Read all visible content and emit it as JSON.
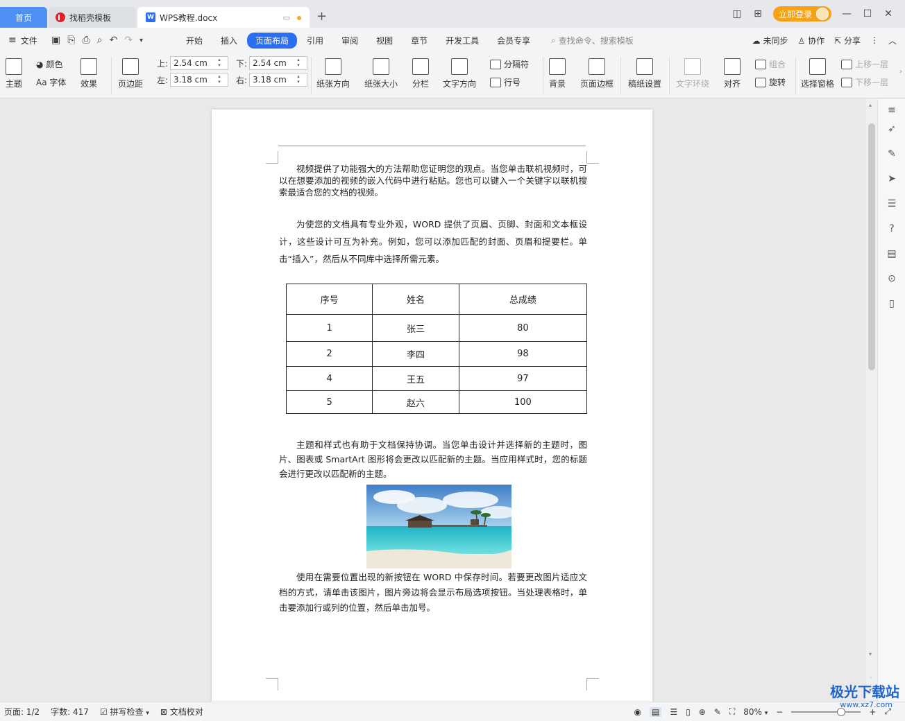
{
  "tabs": {
    "home": "首页",
    "template": "找稻壳模板",
    "document": "WPS教程.docx"
  },
  "titlebar": {
    "login": "立即登录"
  },
  "menubar": {
    "file": "文件",
    "tabs": [
      "开始",
      "插入",
      "页面布局",
      "引用",
      "审阅",
      "视图",
      "章节",
      "开发工具",
      "会员专享"
    ],
    "active_tab": "页面布局",
    "search_placeholder": "查找命令、搜索模板",
    "sync": "未同步",
    "collab": "协作",
    "share": "分享"
  },
  "ribbon": {
    "theme": "主题",
    "color": "颜色",
    "font": "Aa 字体",
    "effect": "效果",
    "margins": "页边距",
    "margin_top_label": "上:",
    "margin_top": "2.54 cm",
    "margin_bottom_label": "下:",
    "margin_bottom": "2.54 cm",
    "margin_left_label": "左:",
    "margin_left": "3.18 cm",
    "margin_right_label": "右:",
    "margin_right": "3.18 cm",
    "orientation": "纸张方向",
    "size": "纸张大小",
    "columns": "分栏",
    "text_direction": "文字方向",
    "breaks": "分隔符",
    "line_numbers": "行号",
    "background": "背景",
    "page_border": "页面边框",
    "draft_settings": "稿纸设置",
    "text_wrap": "文字环绕",
    "align": "对齐",
    "group": "组合",
    "rotate": "旋转",
    "selection_pane": "选择窗格",
    "bring_forward": "上移一层",
    "send_backward": "下移一层"
  },
  "document": {
    "para1": "视频提供了功能强大的方法帮助您证明您的观点。当您单击联机视频时，可以在想要添加的视频的嵌入代码中进行粘贴。您也可以键入一个关键字以联机搜索最适合您的文档的视频。",
    "para2": "为使您的文档具有专业外观，WORD 提供了页眉、页脚、封面和文本框设计，这些设计可互为补充。例如，您可以添加匹配的封面、页眉和提要栏。单击“插入”，然后从不同库中选择所需元素。",
    "table": {
      "headers": [
        "序号",
        "姓名",
        "总成绩"
      ],
      "rows": [
        [
          "1",
          "张三",
          "80"
        ],
        [
          "2",
          "李四",
          "98"
        ],
        [
          "4",
          "王五",
          "97"
        ],
        [
          "5",
          "赵六",
          "100"
        ]
      ]
    },
    "para3": "主题和样式也有助于文档保持协调。当您单击设计并选择新的主题时，图片、图表或 SmartArt 图形将会更改以匹配新的主题。当应用样式时，您的标题会进行更改以匹配新的主题。",
    "para4": "使用在需要位置出现的新按钮在 WORD 中保存时间。若要更改图片适应文档的方式，请单击该图片，图片旁边将会显示布局选项按钮。当处理表格时，单击要添加行或列的位置，然后单击加号。"
  },
  "statusbar": {
    "page": "页面: 1/2",
    "words": "字数: 417",
    "spell": "拼写检查",
    "proof": "文档校对",
    "zoom": "80%"
  },
  "watermark": {
    "main": "极光下载站",
    "sub": "www.xz7.com"
  }
}
